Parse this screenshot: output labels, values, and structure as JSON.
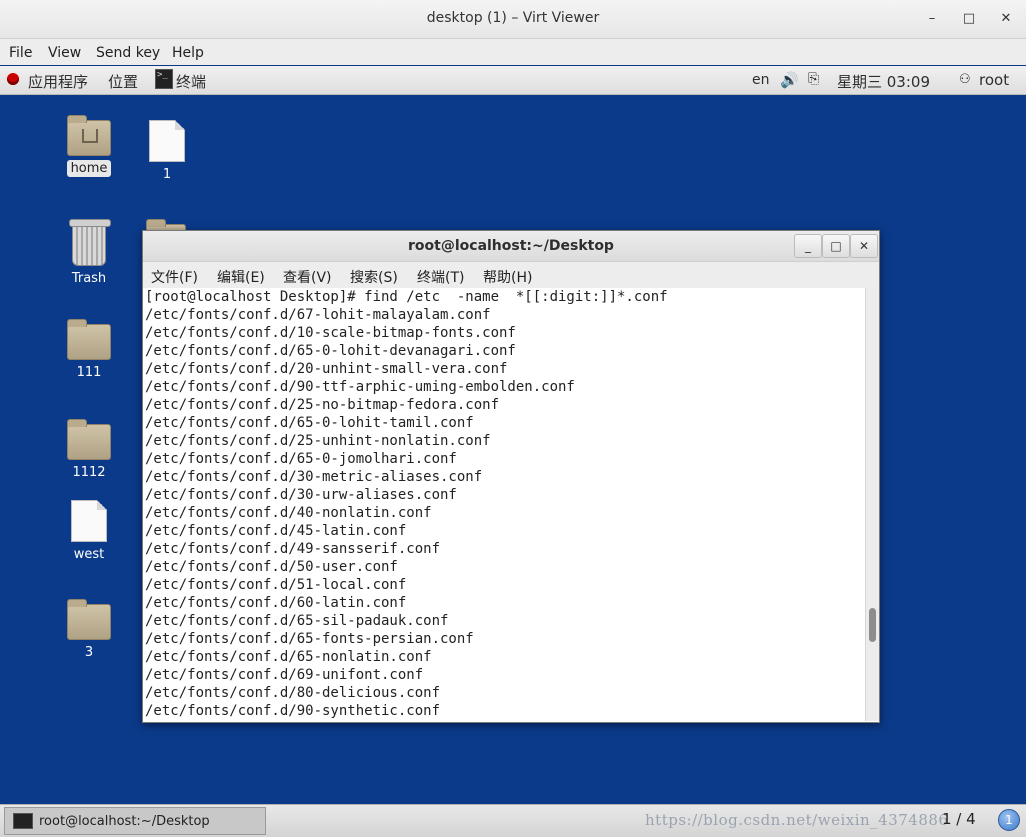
{
  "viewer": {
    "title": "desktop (1) – Virt Viewer",
    "menu": [
      "File",
      "View",
      "Send key",
      "Help"
    ],
    "minimize": "–",
    "maximize": "□",
    "close": "✕"
  },
  "panel": {
    "applications": "应用程序",
    "places": "位置",
    "terminal_task": "终端",
    "lang": "en",
    "volume_icon": "speaker-icon",
    "network_icon": "network-icon",
    "clock": "星期三 03:09",
    "user": "root"
  },
  "desktop": {
    "icons": [
      {
        "label": "home",
        "type": "home-folder"
      },
      {
        "label": "1",
        "type": "file"
      },
      {
        "label": "Trash",
        "type": "trash"
      },
      {
        "label": "111",
        "type": "folder"
      },
      {
        "label": "1112",
        "type": "folder"
      },
      {
        "label": "west",
        "type": "file"
      },
      {
        "label": "3",
        "type": "folder"
      }
    ]
  },
  "terminal": {
    "title": "root@localhost:~/Desktop",
    "menu": [
      "文件(F)",
      "编辑(E)",
      "查看(V)",
      "搜索(S)",
      "终端(T)",
      "帮助(H)"
    ],
    "lines": [
      "[root@localhost Desktop]# find /etc  -name  *[[:digit:]]*.conf",
      "/etc/fonts/conf.d/67-lohit-malayalam.conf",
      "/etc/fonts/conf.d/10-scale-bitmap-fonts.conf",
      "/etc/fonts/conf.d/65-0-lohit-devanagari.conf",
      "/etc/fonts/conf.d/20-unhint-small-vera.conf",
      "/etc/fonts/conf.d/90-ttf-arphic-uming-embolden.conf",
      "/etc/fonts/conf.d/25-no-bitmap-fedora.conf",
      "/etc/fonts/conf.d/65-0-lohit-tamil.conf",
      "/etc/fonts/conf.d/25-unhint-nonlatin.conf",
      "/etc/fonts/conf.d/65-0-jomolhari.conf",
      "/etc/fonts/conf.d/30-metric-aliases.conf",
      "/etc/fonts/conf.d/30-urw-aliases.conf",
      "/etc/fonts/conf.d/40-nonlatin.conf",
      "/etc/fonts/conf.d/45-latin.conf",
      "/etc/fonts/conf.d/49-sansserif.conf",
      "/etc/fonts/conf.d/50-user.conf",
      "/etc/fonts/conf.d/51-local.conf",
      "/etc/fonts/conf.d/60-latin.conf",
      "/etc/fonts/conf.d/65-sil-padauk.conf",
      "/etc/fonts/conf.d/65-fonts-persian.conf",
      "/etc/fonts/conf.d/65-nonlatin.conf",
      "/etc/fonts/conf.d/69-unifont.conf",
      "/etc/fonts/conf.d/80-delicious.conf",
      "/etc/fonts/conf.d/90-synthetic.conf"
    ]
  },
  "taskbar": {
    "window_label": "root@localhost:~/Desktop",
    "watermark": "https://blog.csdn.net/weixin_4374886",
    "pager": "1 / 4",
    "pager_button": "1"
  }
}
